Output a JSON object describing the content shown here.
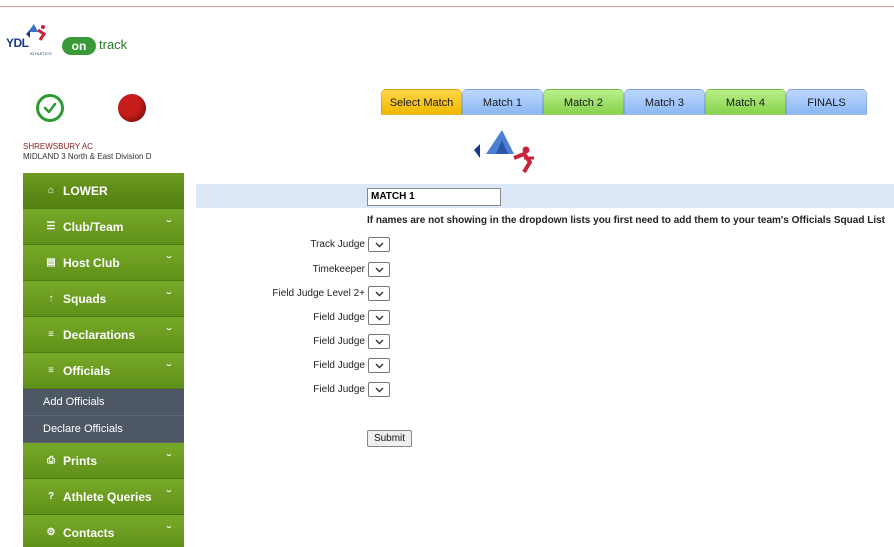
{
  "brand": {
    "ydl": "YDL",
    "athletics": "ATHLETICS",
    "on": "on",
    "track": "track"
  },
  "club": {
    "name": "SHREWSBURY AC",
    "division": "MIDLAND 3 North & East Division D"
  },
  "sidebar": {
    "items": [
      {
        "label": "LOWER",
        "icon": "home-icon"
      },
      {
        "label": "Club/Team",
        "icon": "database-icon"
      },
      {
        "label": "Host Club",
        "icon": "keyboard-icon"
      },
      {
        "label": "Squads",
        "icon": "arrow-up-icon"
      },
      {
        "label": "Declarations",
        "icon": "list-icon"
      },
      {
        "label": "Officials",
        "icon": "list-icon"
      }
    ],
    "sub_items": [
      {
        "label": "Add Officials"
      },
      {
        "label": "Declare Officials"
      }
    ],
    "items_after": [
      {
        "label": "Prints",
        "icon": "print-icon"
      },
      {
        "label": "Athlete Queries",
        "icon": "question-icon"
      },
      {
        "label": "Contacts",
        "icon": "cogs-icon"
      }
    ]
  },
  "tabs": [
    {
      "label": "Select Match",
      "state": "selected",
      "color": "#f5c518"
    },
    {
      "label": "Match 1",
      "color": "#9ec4fa"
    },
    {
      "label": "Match 2",
      "color": "#9fe06a"
    },
    {
      "label": "Match 3",
      "color": "#9ec4fa"
    },
    {
      "label": "Match 4",
      "color": "#9fe06a"
    },
    {
      "label": "FINALS",
      "color": "#9ec4fa"
    }
  ],
  "form": {
    "match_value": "MATCH 1",
    "notice": "If names are not showing in the dropdown lists you first need to add them to your team's Officials Squad List",
    "fields": [
      {
        "label": "Track Judge"
      },
      {
        "label": "Timekeeper"
      },
      {
        "label": "Field Judge Level 2+"
      },
      {
        "label": "Field Judge"
      },
      {
        "label": "Field Judge"
      },
      {
        "label": "Field Judge"
      },
      {
        "label": "Field Judge"
      }
    ],
    "submit_label": "Submit"
  }
}
